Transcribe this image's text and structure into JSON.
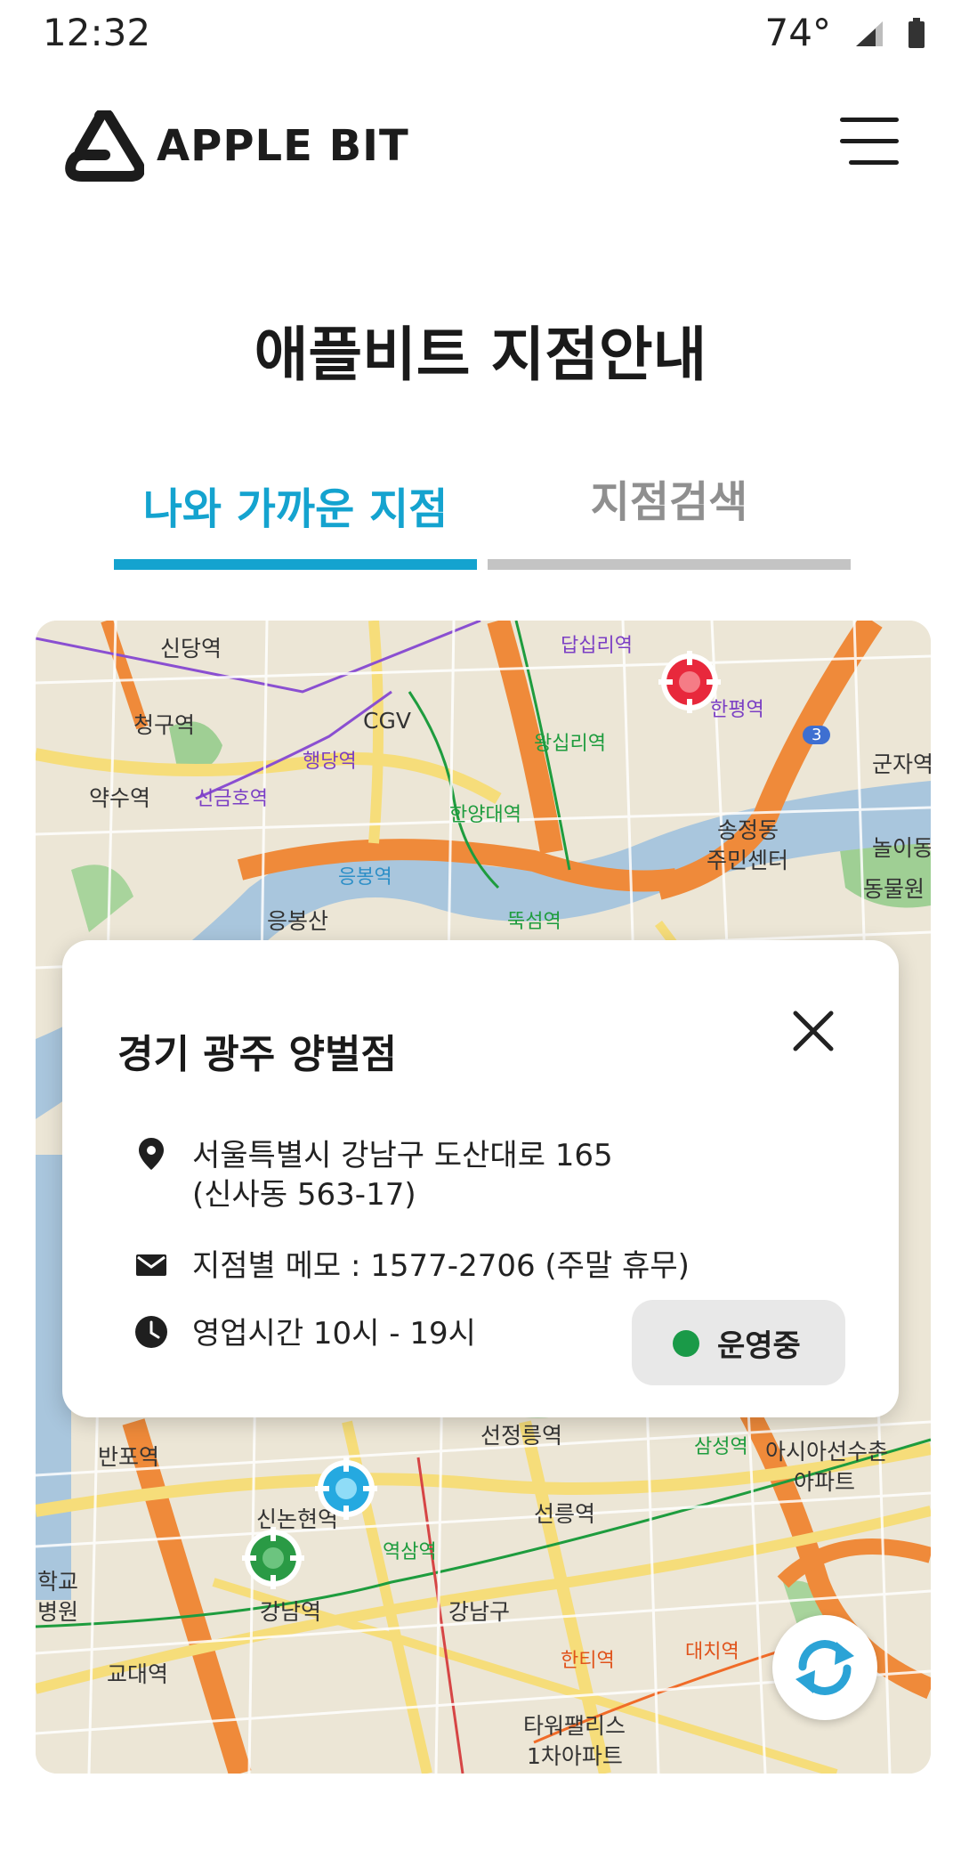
{
  "status_bar": {
    "time": "12:32",
    "temperature": "74°",
    "icons": [
      "signal-icon",
      "battery-icon"
    ]
  },
  "header": {
    "logo_text": "APPLE BIT",
    "menu_icon": "hamburger-menu-icon"
  },
  "page": {
    "title": "애플비트 지점안내"
  },
  "tabs": [
    {
      "label": "나와 가까운 지점",
      "active": true
    },
    {
      "label": "지점검색",
      "active": false
    }
  ],
  "colors": {
    "accent": "#14a3cf",
    "inactive_tab": "#8f8f8f",
    "open_status": "#1a9a48",
    "marker_red": "#e8283c",
    "marker_blue": "#25a9e0",
    "marker_green": "#2a9a45"
  },
  "map": {
    "labels": [
      "신당역",
      "청구역",
      "약수역",
      "CGV",
      "신금호역",
      "행당역",
      "응봉산",
      "응봉역",
      "한양대역",
      "왕십리역",
      "답십리역",
      "한평역",
      "3",
      "군자역",
      "송정동",
      "주민센터",
      "놀이동",
      "동물원",
      "뚝섬역",
      "선정릉역",
      "선릉역",
      "삼성역",
      "아시아선수촌",
      "아파트",
      "반포역",
      "신논현역",
      "역삼역",
      "강남역",
      "강남구",
      "교대역",
      "대치역",
      "한티역",
      "타워팰리스",
      "1차아파트",
      "학교",
      "병원"
    ]
  },
  "branch_popup": {
    "title": "경기 광주 양벌점",
    "address_line1": "서울특별시 강남구 도산대로 165",
    "address_line2": "(신사동 563-17)",
    "memo": "지점별 메모 : 1577-2706 (주말 휴무)",
    "hours": "영업시간 10시 - 19시",
    "status_label": "운영중",
    "icons": [
      "location-pin-icon",
      "mail-icon",
      "clock-icon",
      "close-icon"
    ]
  },
  "controls": {
    "refresh_icon": "refresh-icon"
  }
}
